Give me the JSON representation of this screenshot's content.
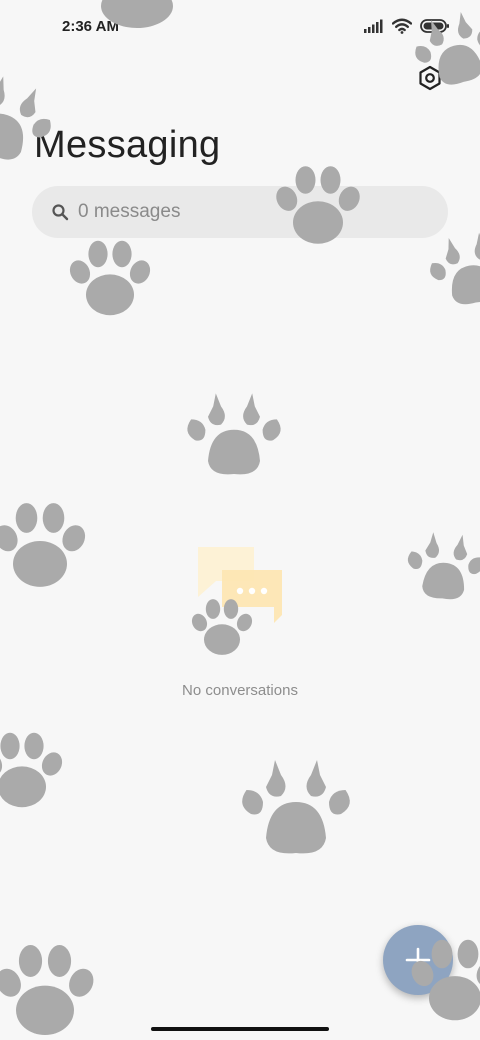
{
  "status_bar": {
    "time": "2:36 AM",
    "icons": [
      "signal-icon",
      "wifi-icon",
      "battery-icon"
    ]
  },
  "header": {
    "settings_icon": "gear-icon",
    "title": "Messaging"
  },
  "search": {
    "icon": "search-icon",
    "text": "0 messages"
  },
  "empty_state": {
    "icon": "conversation-bubbles-icon",
    "text": "No conversations"
  },
  "fab": {
    "icon": "plus-icon",
    "color": "#8ea4c1"
  },
  "theme": {
    "background": "#f7f7f7",
    "paw_color": "#aaaaaa",
    "bubble_back": "#fdf2d6",
    "bubble_front": "#fde6b3"
  }
}
